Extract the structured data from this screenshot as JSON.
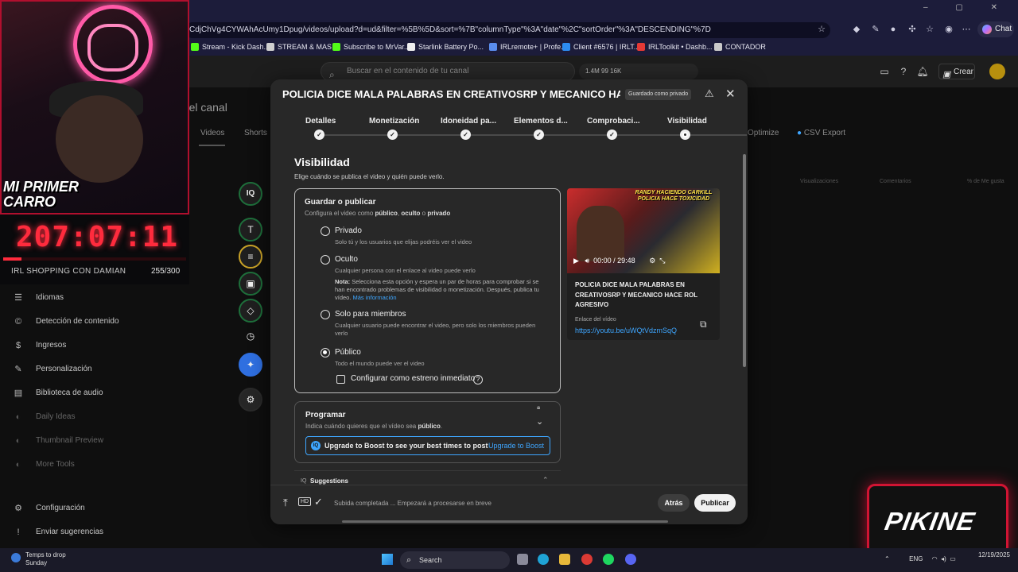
{
  "browser": {
    "url": "CdjChVg4CYWAhAcUmy1Dpug/videos/upload?d=ud&filter=%5B%5D&sort=%7B\"columnType\"%3A\"date\"%2C\"sortOrder\"%3A\"DESCENDING\"%7D",
    "chat_label": "Chat",
    "bookmarks": [
      {
        "label": "Stream - Kick Dash...",
        "color": "#53fc18"
      },
      {
        "label": "STREAM & MAS",
        "color": "#cfcfcf"
      },
      {
        "label": "Subscribe to MrVar...",
        "color": "#53fc18"
      },
      {
        "label": "Starlink Battery Po...",
        "color": "#eeeeee"
      },
      {
        "label": "IRLremote+ | Profe...",
        "color": "#5a8dee"
      },
      {
        "label": "Client #6576 | IRLT...",
        "color": "#2d8cf0"
      },
      {
        "label": "IRLToolkit • Dashb...",
        "color": "#e53935"
      },
      {
        "label": "CONTADOR",
        "color": "#c9c9c9"
      }
    ]
  },
  "yt_header": {
    "search_placeholder": "Buscar en el contenido de tu canal",
    "stats": "1.4M  99  16K",
    "create_label": "Crear"
  },
  "background": {
    "page_title": "lo del canal",
    "tabs": [
      "Videos",
      "Shorts"
    ],
    "right_tabs": [
      "Optimize",
      "CSV Export"
    ],
    "columns": [
      "Visualizaciones",
      "Comentarios",
      "% de Me gusta"
    ]
  },
  "stream_overlay": {
    "webcam_text": "MI PRIMER CARRO",
    "timer": "207:07:11",
    "progress": 0.1,
    "label": "IRL SHOPPING CON DAMIAN",
    "count": "255/300"
  },
  "sidebar": {
    "items": [
      {
        "label": "Idiomas",
        "icon": "translate-icon",
        "glyph": "☰"
      },
      {
        "label": "Detección de contenido",
        "icon": "copyright-icon",
        "glyph": "©"
      },
      {
        "label": "Ingresos",
        "icon": "dollar-icon",
        "glyph": "$"
      },
      {
        "label": "Personalización",
        "icon": "magic-wand-icon",
        "glyph": "✎"
      },
      {
        "label": "Biblioteca de audio",
        "icon": "audio-library-icon",
        "glyph": "▤"
      },
      {
        "label": "Daily Ideas",
        "icon": "ideas-icon",
        "glyph": "◐"
      },
      {
        "label": "Thumbnail Preview",
        "icon": "thumbnail-icon",
        "glyph": "◐"
      },
      {
        "label": "More Tools",
        "icon": "tools-icon",
        "glyph": "◐"
      },
      {
        "label": "Configuración",
        "icon": "settings-icon",
        "glyph": "⚙"
      },
      {
        "label": "Enviar sugerencias",
        "icon": "feedback-icon",
        "glyph": "!"
      }
    ]
  },
  "rail": {
    "buttons": [
      {
        "name": "vidiq-button",
        "glyph": "IQ"
      },
      {
        "name": "title-tool-button",
        "glyph": "T"
      },
      {
        "name": "description-tool-button",
        "glyph": "≡"
      },
      {
        "name": "thumbnail-tool-button",
        "glyph": "▣"
      },
      {
        "name": "tags-tool-button",
        "glyph": "◇"
      },
      {
        "name": "history-button",
        "glyph": "◷"
      },
      {
        "name": "ai-button",
        "glyph": "✦"
      },
      {
        "name": "rail-settings-button",
        "glyph": "⚙"
      }
    ]
  },
  "modal": {
    "title": "POLICIA DICE MALA PALABRAS EN CREATIVOSRP Y MECANICO HACE R...",
    "badge": "Guardado como privado",
    "steps": [
      "Detalles",
      "Monetización",
      "Idoneidad pa...",
      "Elementos d...",
      "Comprobaci...",
      "Visibilidad"
    ],
    "visibility": {
      "title": "Visibilidad",
      "subtitle": "Elige cuándo se publica el video y quién puede verlo.",
      "save_title": "Guardar o publicar",
      "save_sub_1": "Configura el video como ",
      "save_sub_b1": "público",
      "save_sub_2": ", ",
      "save_sub_b2": "oculto",
      "save_sub_3": " o ",
      "save_sub_b3": "privado",
      "options": [
        {
          "label": "Privado",
          "desc": "Solo tú y los usuarios que elijas podréis ver el video",
          "selected": false
        },
        {
          "label": "Oculto",
          "desc": "Cualquier persona con el enlace al video puede verlo",
          "selected": false
        },
        {
          "label": "Solo para miembros",
          "desc": "Cualquier usuario puede encontrar el video, pero solo los miembros pueden verlo",
          "selected": false
        },
        {
          "label": "Público",
          "desc": "Todo el mundo puede ver el video",
          "selected": true
        }
      ],
      "note_bold": "Nota:",
      "note_text": " Selecciona esta opción y espera un par de horas para comprobar si se han encontrado problemas de visibilidad o monetización. Después, publica tu vídeo. ",
      "note_link": "Más información",
      "premiere_label": "Configurar como estreno inmediato"
    },
    "preview": {
      "thumb_text": "RANDY HACIENDO CARKILL POLICIA HACE TOXICIDAD",
      "time": "00:00 / 29:48",
      "title": "POLICIA DICE MALA PALABRAS EN CREATIVOSRP Y MECANICO HACE ROL AGRESIVO",
      "link_label": "Enlace del vídeo",
      "link": "https://youtu.be/uWQtVdzmSqQ"
    },
    "schedule": {
      "title": "Programar",
      "sub_1": "Indica cuándo quieres que el vídeo sea ",
      "sub_b": "público",
      "sub_2": ".",
      "boost_text": "Upgrade to Boost to see your best times to post",
      "boost_link": "Upgrade to Boost"
    },
    "suggestions_label": "Suggestions",
    "footer": {
      "status": "Subida completada ... Empezará a procesarse en breve",
      "back": "Atrás",
      "publish": "Publicar"
    }
  },
  "pikine": "PIKINE",
  "taskbar": {
    "weather_line1": "Temps to drop",
    "weather_line2": "Sunday",
    "search": "Search",
    "tray": "ENG",
    "clock_time": "",
    "clock_date": "12/19/2025"
  }
}
